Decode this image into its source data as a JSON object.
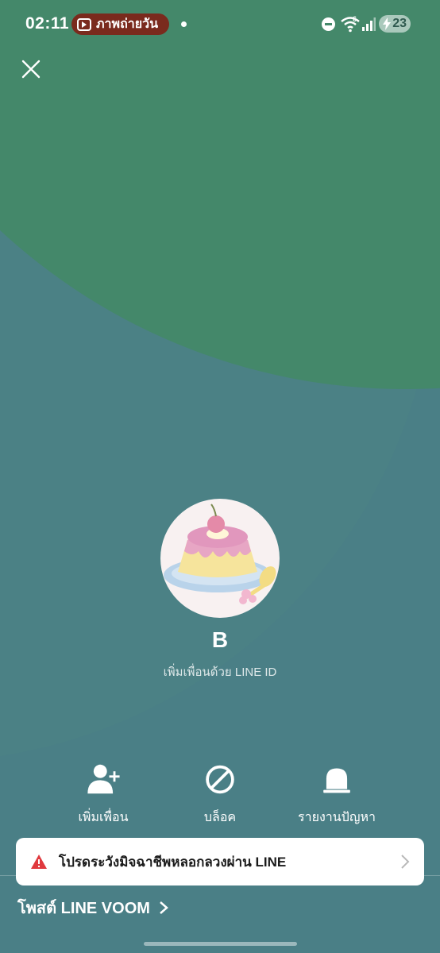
{
  "status_bar": {
    "time": "02:11",
    "notification_pill": "ภาพถ่ายวัน",
    "battery": "23"
  },
  "profile": {
    "name": "B",
    "subtitle": "เพิ่มเพื่อนด้วย LINE ID",
    "avatar_icon": "pudding-avatar"
  },
  "actions": [
    {
      "label": "เพิ่มเพื่อน",
      "icon": "add-friend-icon"
    },
    {
      "label": "บล็อค",
      "icon": "block-icon"
    },
    {
      "label": "รายงานปัญหา",
      "icon": "report-icon"
    }
  ],
  "warning": {
    "text": "โปรดระวังมิจฉาชีพหลอกลวงผ่าน LINE"
  },
  "voom_link": "โพสต์ LINE VOOM",
  "colors": {
    "top_bg": "#44886a",
    "bottom_bg": "#4a7f86",
    "pill_bg": "#7a2a1d",
    "warning_icon": "#e0393e"
  }
}
